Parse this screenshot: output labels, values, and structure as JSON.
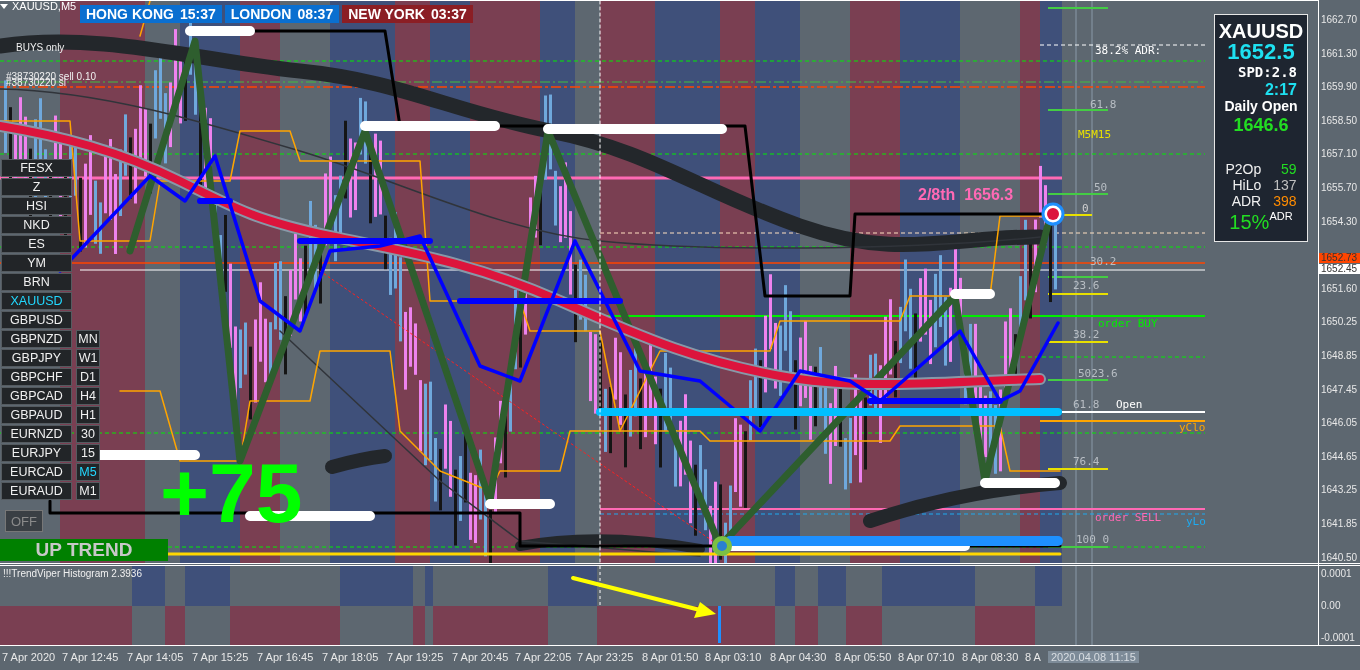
{
  "chart": {
    "symbol": "XAUUSD,M5",
    "sessions": [
      {
        "city": "HONG KONG",
        "time": "15:37",
        "color": "#0a6fd0"
      },
      {
        "city": "LONDON",
        "time": "08:37",
        "color": "#0a6fd0"
      },
      {
        "city": "NEW YORK",
        "time": "03:37",
        "color": "#8b1e24"
      }
    ],
    "notes": [
      "BUYS only",
      "#38730220 sell 0.10",
      "#38730220 sl"
    ],
    "octave_label": "2/8th  1656.3",
    "level_labels": [
      {
        "text": "38.2% ADR:",
        "color": "#ffffff"
      },
      {
        "text": "61.8",
        "color": "#b8bec4"
      },
      {
        "text": "M5M15",
        "color": "#e8e000"
      },
      {
        "text": "50",
        "color": "#b8bec4"
      },
      {
        "text": "0",
        "color": "#d0d0d0"
      },
      {
        "text": "30.2",
        "color": "#b8bec4"
      },
      {
        "text": "23.6",
        "color": "#b8bec4"
      },
      {
        "text": "order BUY",
        "color": "#00ee00"
      },
      {
        "text": "38.2",
        "color": "#b8bec4"
      },
      {
        "text": "5023.6",
        "color": "#b8bec4"
      },
      {
        "text": "61.8",
        "color": "#b8bec4"
      },
      {
        "text": "Open",
        "color": "#ffffff"
      },
      {
        "text": "yClo",
        "color": "#ffa500"
      },
      {
        "text": "76.4",
        "color": "#b8bec4"
      },
      {
        "text": "order SELL",
        "color": "#ff69b4"
      },
      {
        "text": "yLo",
        "color": "#1eaaf0"
      },
      {
        "text": "100 0",
        "color": "#b8bec4"
      }
    ],
    "profit": "+75",
    "trend": "UP TREND",
    "toggle": {
      "label": "OFF",
      "on": false
    }
  },
  "symbols": [
    {
      "label": "FESX",
      "selected": false
    },
    {
      "label": "Z",
      "selected": false
    },
    {
      "label": "HSI",
      "selected": false
    },
    {
      "label": "NKD",
      "selected": false
    },
    {
      "label": "ES",
      "selected": false
    },
    {
      "label": "YM",
      "selected": false
    },
    {
      "label": "BRN",
      "selected": false
    },
    {
      "label": "XAUUSD",
      "selected": true
    },
    {
      "label": "GBPUSD",
      "selected": false
    },
    {
      "label": "GBPNZD",
      "selected": false
    },
    {
      "label": "GBPJPY",
      "selected": false
    },
    {
      "label": "GBPCHF",
      "selected": false
    },
    {
      "label": "GBPCAD",
      "selected": false
    },
    {
      "label": "GBPAUD",
      "selected": false
    },
    {
      "label": "EURNZD",
      "selected": false
    },
    {
      "label": "EURJPY",
      "selected": false
    },
    {
      "label": "EURCAD",
      "selected": false
    },
    {
      "label": "EURAUD",
      "selected": false
    }
  ],
  "timeframes": [
    {
      "label": "MN",
      "selected": false
    },
    {
      "label": "W1",
      "selected": false
    },
    {
      "label": "D1",
      "selected": false
    },
    {
      "label": "H4",
      "selected": false
    },
    {
      "label": "H1",
      "selected": false
    },
    {
      "label": "30",
      "selected": false
    },
    {
      "label": "15",
      "selected": false
    },
    {
      "label": "M5",
      "selected": true
    },
    {
      "label": "M1",
      "selected": false
    }
  ],
  "info_panel": {
    "symbol": "XAUUSD",
    "price": "1652.5",
    "spread": "SPD:2.8",
    "timer": "2:17",
    "daily_open_label": "Daily Open",
    "daily_open": "1646.6",
    "stats": [
      {
        "label": "P2Op",
        "value": "59",
        "color": "#22dd22"
      },
      {
        "label": "HiLo",
        "value": "137",
        "color": "#c0c0c0"
      },
      {
        "label": "ADR",
        "value": "398",
        "color": "#ff8c00"
      }
    ],
    "adr_percent": "15%",
    "adr_suffix": "ADR"
  },
  "price_axis": {
    "ticks": [
      "1662.70",
      "1661.30",
      "1659.90",
      "1658.50",
      "1657.10",
      "1655.70",
      "1654.30",
      "1651.60",
      "1650.25",
      "1648.85",
      "1647.45",
      "1646.05",
      "1644.65",
      "1643.25",
      "1641.85",
      "1640.50"
    ],
    "markers": [
      {
        "value": "1652.73",
        "color": "#ff4500"
      },
      {
        "value": "1652.45",
        "color": "#ffffff"
      }
    ]
  },
  "indicator": {
    "title": "!!!TrendViper Histogram 2.3936",
    "ticks": [
      "0.0001",
      "0.00",
      "-0.0001"
    ]
  },
  "time_axis": {
    "ticks": [
      "7 Apr 2020",
      "7 Apr 12:45",
      "7 Apr 14:05",
      "7 Apr 15:25",
      "7 Apr 16:45",
      "7 Apr 18:05",
      "7 Apr 19:25",
      "7 Apr 20:45",
      "7 Apr 22:05",
      "7 Apr 23:25",
      "8 Apr 01:50",
      "8 Apr 03:10",
      "8 Apr 04:30",
      "8 Apr 05:50",
      "8 Apr 07:10",
      "8 Apr 08:30",
      "8 A"
    ],
    "cursor": "2020.04.08 11:15"
  }
}
